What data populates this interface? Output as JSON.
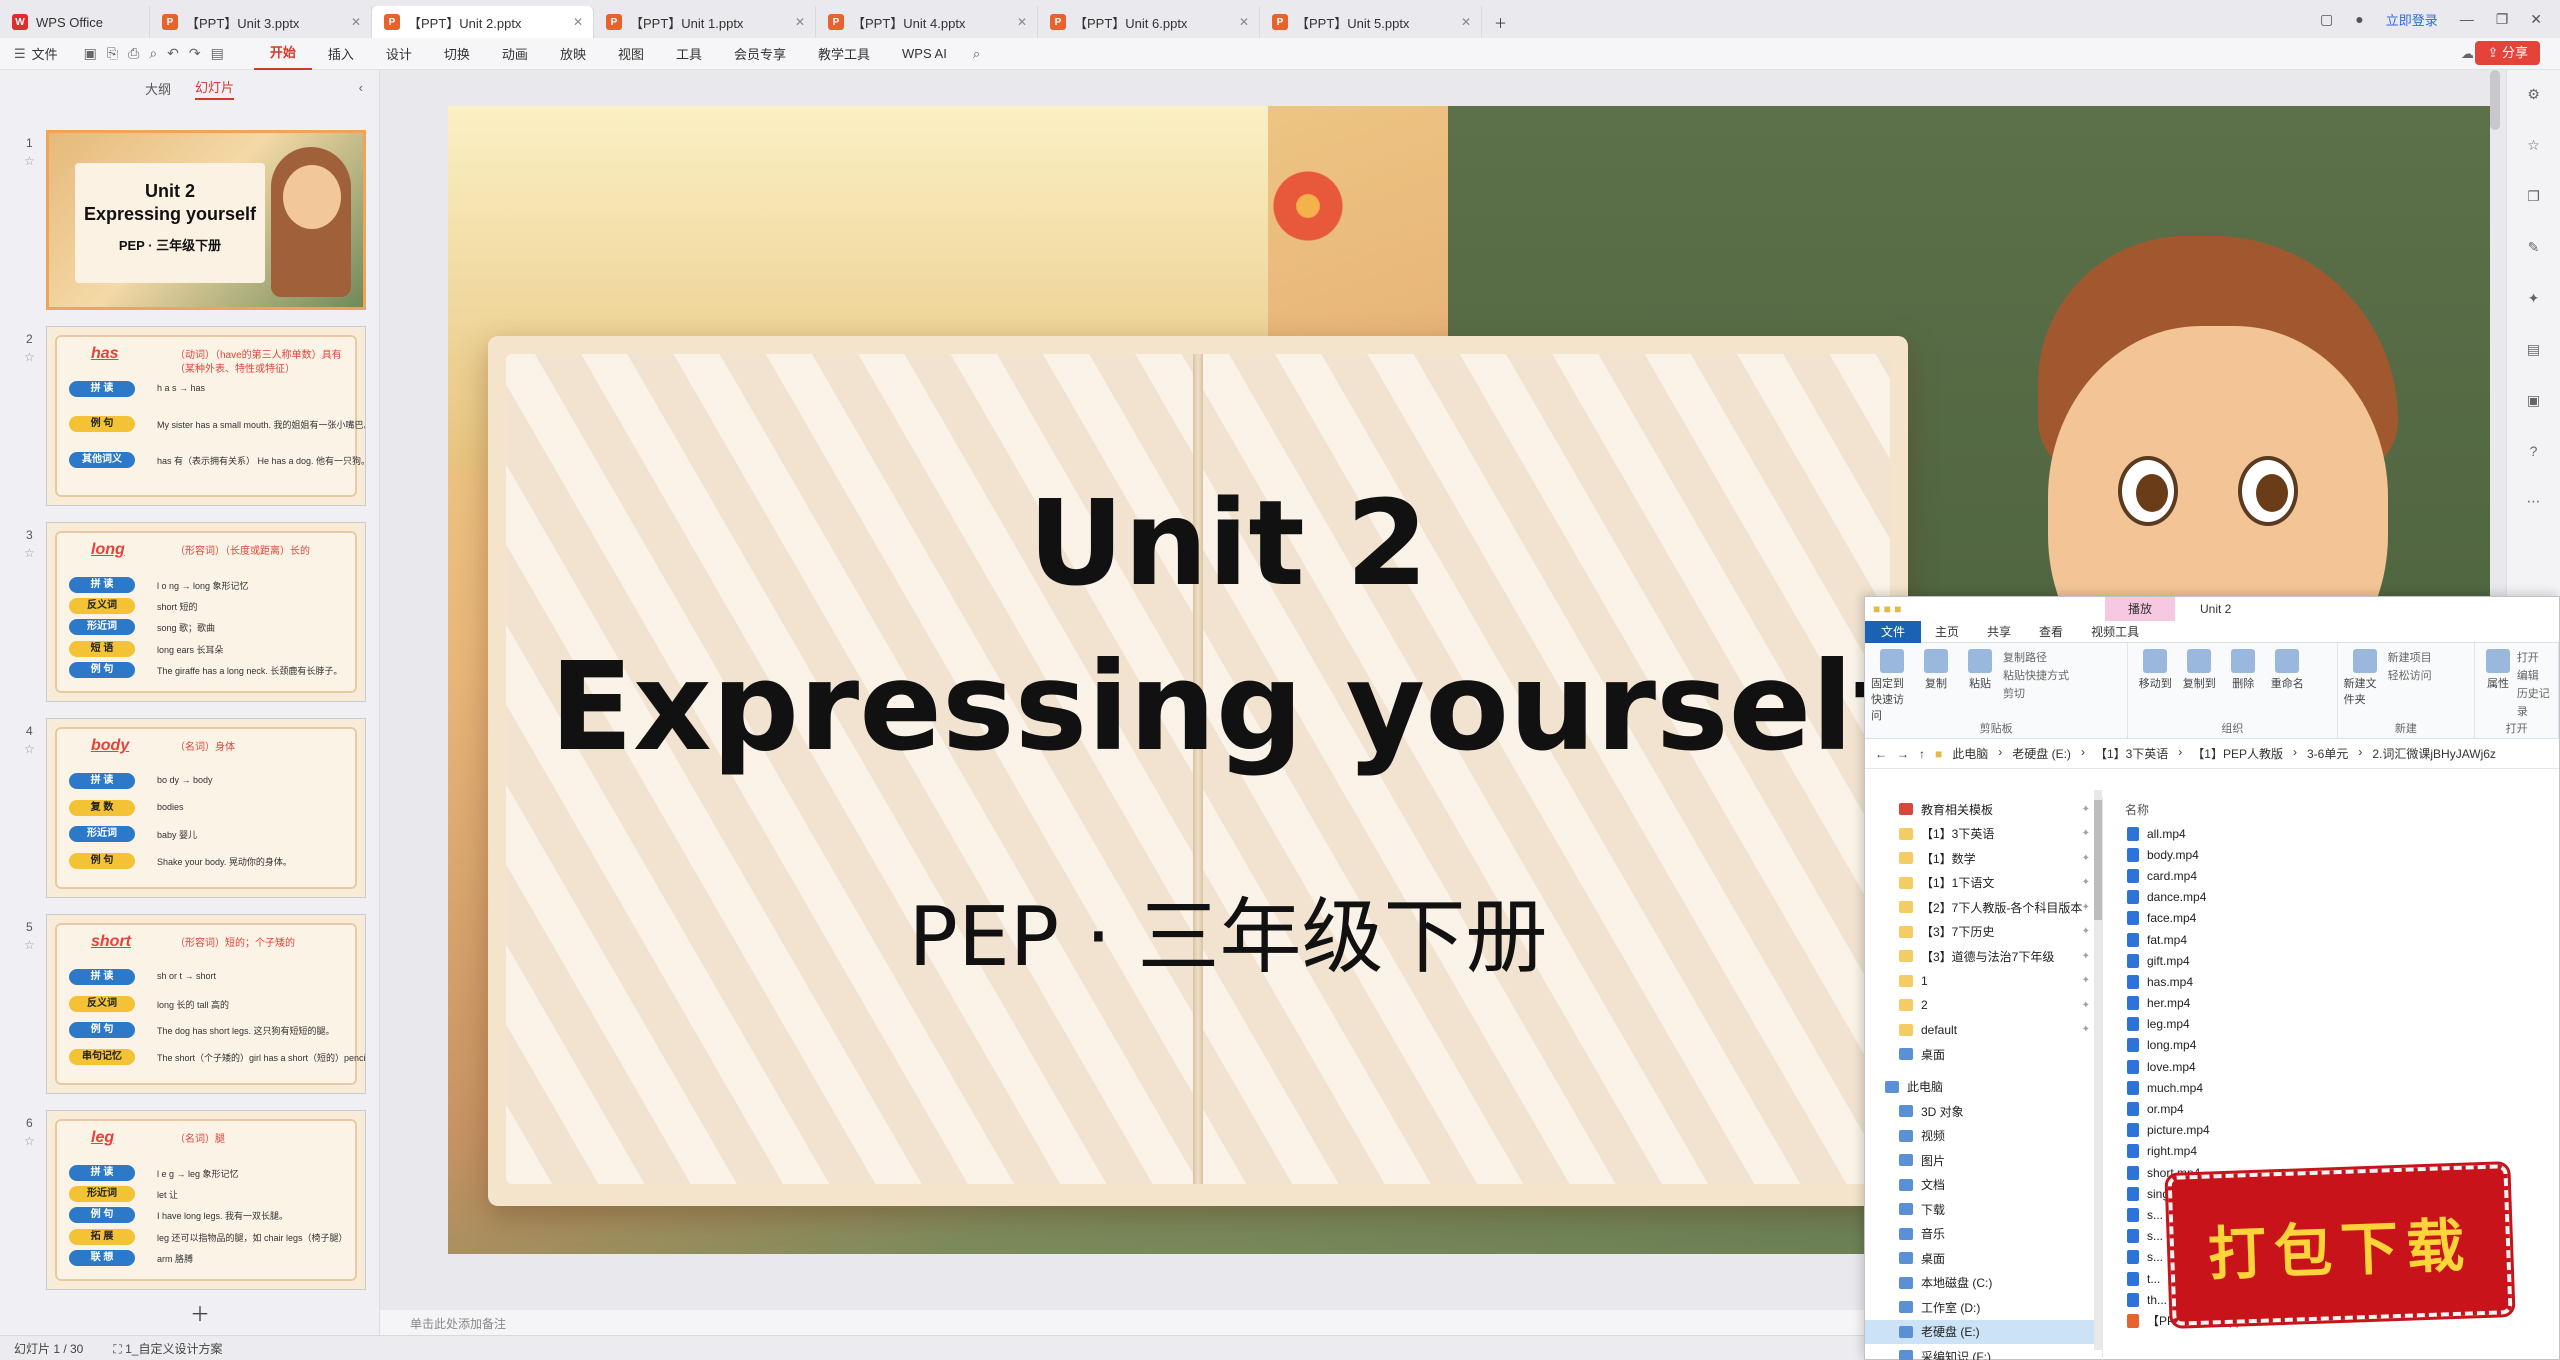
{
  "tabs": [
    {
      "label": "WPS Office",
      "type": "wps"
    },
    {
      "label": "【PPT】Unit 3.pptx",
      "type": "ppt"
    },
    {
      "label": "【PPT】Unit 2.pptx",
      "type": "ppt",
      "active": true
    },
    {
      "label": "【PPT】Unit 1.pptx",
      "type": "ppt"
    },
    {
      "label": "【PPT】Unit 4.pptx",
      "type": "ppt"
    },
    {
      "label": "【PPT】Unit 6.pptx",
      "type": "ppt"
    },
    {
      "label": "【PPT】Unit 5.pptx",
      "type": "ppt"
    }
  ],
  "title_right": {
    "login": "立即登录"
  },
  "menu": {
    "file": "文件",
    "items": [
      "开始",
      "插入",
      "设计",
      "切换",
      "动画",
      "放映",
      "视图",
      "工具",
      "会员专享",
      "教学工具",
      "WPS AI"
    ],
    "share": "分享"
  },
  "left_panel": {
    "tabs": [
      "大纲",
      "幻灯片"
    ],
    "active_tab": "幻灯片"
  },
  "slides": [
    {
      "num": "1",
      "kind": "cover",
      "t1": "Unit 2",
      "t2": "Expressing yourself",
      "t3": "PEP · 三年级下册"
    },
    {
      "num": "2",
      "kind": "vocab",
      "word": "has",
      "meaning": "（动词）（have的第三人称单数）具有（某种外表、特性或特征）",
      "rows": [
        {
          "label": "拼 读",
          "text": "h  a  s  →  has"
        },
        {
          "label": "例 句",
          "text": "My sister has a small mouth. 我的姐姐有一张小嘴巴。"
        },
        {
          "label": "其他词义",
          "text": "has 有（表示拥有关系）   He has a dog. 他有一只狗。"
        }
      ]
    },
    {
      "num": "3",
      "kind": "vocab",
      "word": "long",
      "meaning": "（形容词）（长度或距离）长的",
      "rows": [
        {
          "label": "拼 读",
          "text": "l  o  ng  →  long   象形记忆"
        },
        {
          "label": "反义词",
          "text": "short 短的"
        },
        {
          "label": "形近词",
          "text": "song 歌；歌曲"
        },
        {
          "label": "短 语",
          "text": "long ears 长耳朵"
        },
        {
          "label": "例 句",
          "text": "The giraffe has a long neck. 长颈鹿有长脖子。"
        }
      ]
    },
    {
      "num": "4",
      "kind": "vocab",
      "word": "body",
      "meaning": "（名词）身体",
      "rows": [
        {
          "label": "拼 读",
          "text": "bo  dy  →  body"
        },
        {
          "label": "复 数",
          "text": "bodies"
        },
        {
          "label": "形近词",
          "text": "baby 婴儿"
        },
        {
          "label": "例 句",
          "text": "Shake your body. 晃动你的身体。"
        }
      ]
    },
    {
      "num": "5",
      "kind": "vocab",
      "word": "short",
      "meaning": "（形容词）短的；个子矮的",
      "rows": [
        {
          "label": "拼 读",
          "text": "sh  or  t  →  short"
        },
        {
          "label": "反义词",
          "text": "long 长的     tall 高的"
        },
        {
          "label": "例 句",
          "text": "The dog has short legs. 这只狗有短短的腿。"
        },
        {
          "label": "串句记忆",
          "text": "The short（个子矮的）girl has a short（短的）pencil."
        }
      ]
    },
    {
      "num": "6",
      "kind": "vocab",
      "word": "leg",
      "meaning": "（名词）腿",
      "rows": [
        {
          "label": "拼 读",
          "text": "l  e  g  →  leg   象形记忆"
        },
        {
          "label": "形近词",
          "text": "let 让"
        },
        {
          "label": "例 句",
          "text": "I have long legs. 我有一双长腿。"
        },
        {
          "label": "拓 展",
          "text": "leg 还可以指物品的腿，如 chair legs（椅子腿）"
        },
        {
          "label": "联 想",
          "text": "arm 胳膊"
        }
      ]
    }
  ],
  "main_slide": {
    "line1": "Unit 2",
    "line2": "Expressing yourself",
    "line3": "PEP · 三年级下册"
  },
  "notes_placeholder": "单击此处添加备注",
  "status": {
    "slide_counter": "幻灯片 1 / 30",
    "design": "1_自定义设计方案"
  },
  "explorer": {
    "window_title": "Unit 2",
    "context_tab": "播放",
    "ribbon_tabs": [
      "文件",
      "主页",
      "共享",
      "查看",
      "视频工具"
    ],
    "groups": [
      {
        "name": "剪贴板",
        "buttons": [
          "固定到快速访问",
          "复制",
          "粘贴"
        ],
        "small": [
          "复制路径",
          "粘贴快捷方式",
          "剪切"
        ]
      },
      {
        "name": "组织",
        "buttons": [
          "移动到",
          "复制到",
          "删除",
          "重命名"
        ],
        "small": []
      },
      {
        "name": "新建",
        "buttons": [
          "新建文件夹"
        ],
        "small": [
          "新建项目",
          "轻松访问"
        ]
      },
      {
        "name": "打开",
        "buttons": [
          "属性"
        ],
        "small": [
          "打开",
          "编辑",
          "历史记录"
        ]
      }
    ],
    "address": [
      "此电脑",
      "老硬盘 (E:)",
      "【1】3下英语",
      "【1】PEP人教版",
      "3-6单元",
      "2.词汇微课jBHyJAWj6z"
    ],
    "nav_top": [
      {
        "label": "教育相关模板",
        "pin": true,
        "icon": "red"
      }
    ],
    "nav": [
      {
        "label": "【1】3下英语",
        "pin": true
      },
      {
        "label": "【1】数学",
        "pin": true
      },
      {
        "label": "【1】1下语文",
        "pin": true
      },
      {
        "label": "【2】7下人教版-各个科目版本",
        "pin": true
      },
      {
        "label": "【3】7下历史",
        "pin": true
      },
      {
        "label": "【3】道德与法治7下年级",
        "pin": true
      },
      {
        "label": "1",
        "pin": true
      },
      {
        "label": "2",
        "pin": true
      },
      {
        "label": "default",
        "pin": true
      },
      {
        "label": "桌面",
        "pin": false,
        "blue": true
      }
    ],
    "nav_pc": "此电脑",
    "nav_pc_items": [
      "3D 对象",
      "视频",
      "图片",
      "文档",
      "下载",
      "音乐",
      "桌面",
      "本地磁盘 (C:)",
      "工作室 (D:)",
      "老硬盘 (E:)",
      "采编知识 (F:)"
    ],
    "nav_selected": "老硬盘 (E:)",
    "col_name": "名称",
    "files": [
      "all.mp4",
      "body.mp4",
      "card.mp4",
      "dance.mp4",
      "face.mp4",
      "fat.mp4",
      "gift.mp4",
      "has.mp4",
      "her.mp4",
      "leg.mp4",
      "long.mp4",
      "love.mp4",
      "much.mp4",
      "or.mp4",
      "picture.mp4",
      "right.mp4",
      "short.mp4",
      "sing.mp4",
      "s...",
      "s...",
      "s...",
      "t...",
      "th...",
      "【PPT】Unit 2.pptx"
    ]
  },
  "promo": {
    "text": "打包下载"
  }
}
